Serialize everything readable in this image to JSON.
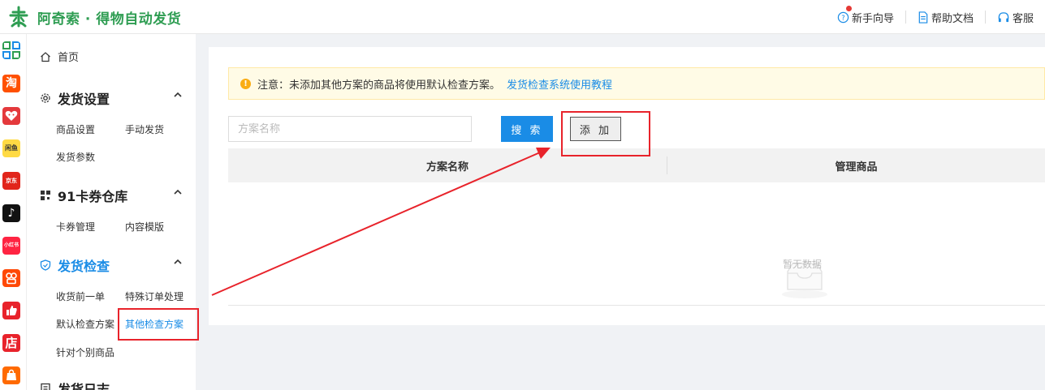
{
  "header": {
    "app_title": "阿奇索 · 得物自动发货",
    "links": [
      {
        "label": "新手向导",
        "icon": "question-circle-icon"
      },
      {
        "label": "帮助文档",
        "icon": "document-icon"
      },
      {
        "label": "客服",
        "icon": "headset-icon"
      }
    ]
  },
  "platforms": [
    {
      "name": "grid-apps-icon",
      "glyph": "",
      "color": "#2e9d52"
    },
    {
      "name": "taobao-icon",
      "glyph": "淘",
      "color": "#ff5000"
    },
    {
      "name": "tmall-icon",
      "glyph": "",
      "color": "#e4393c"
    },
    {
      "name": "xianyu-icon",
      "glyph": "闲鱼",
      "color": "#ffda44"
    },
    {
      "name": "jd-icon",
      "glyph": "京东",
      "color": "#e1251b"
    },
    {
      "name": "douyin-icon",
      "glyph": "♪",
      "color": "#111111"
    },
    {
      "name": "xiaohongshu-icon",
      "glyph": "小红书",
      "color": "#ff2442"
    },
    {
      "name": "kuaishou-icon",
      "glyph": "",
      "color": "#ff4906"
    },
    {
      "name": "thumbs-up-icon",
      "glyph": "",
      "color": "#e8232b"
    },
    {
      "name": "dian-icon",
      "glyph": "店",
      "color": "#e8232b"
    },
    {
      "name": "shop-bag-icon",
      "glyph": "",
      "color": "#ff6a00"
    }
  ],
  "menu": {
    "home": "首页",
    "sections": [
      {
        "title": "发货设置",
        "items": [
          "商品设置",
          "手动发货",
          "发货参数"
        ]
      },
      {
        "title": "91卡券仓库",
        "items": [
          "卡券管理",
          "内容模版"
        ]
      },
      {
        "title": "发货检查",
        "items": [
          "收货前一单",
          "特殊订单处理",
          "默认检查方案",
          "其他检查方案",
          "针对个别商品"
        ]
      },
      {
        "title": "发货日志"
      }
    ]
  },
  "main": {
    "notice_text": "注意：未添加其他方案的商品将使用默认检查方案。",
    "notice_link": "发货检查系统使用教程",
    "search_placeholder": "方案名称",
    "search_button": "搜 索",
    "add_button": "添 加",
    "columns": [
      "方案名称",
      "管理商品"
    ],
    "empty_text": "暂无数据"
  },
  "colors": {
    "brand_green": "#2e9d52",
    "accent_blue": "#1a8ce6",
    "highlight_red": "#e8232b"
  }
}
